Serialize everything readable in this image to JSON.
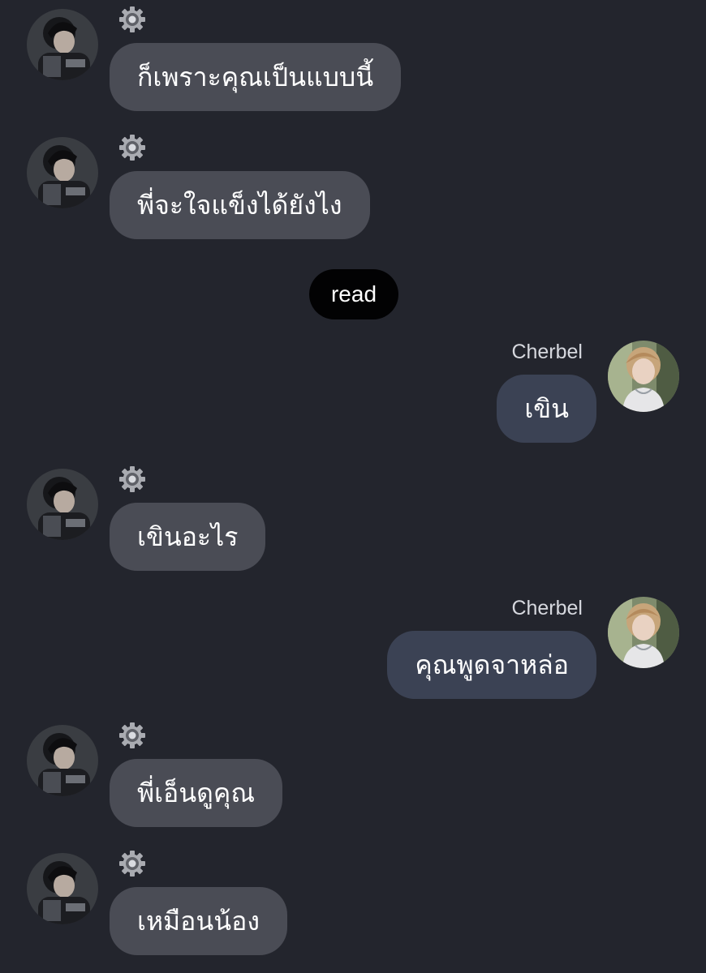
{
  "read_label": "read",
  "contact": {
    "name": "Cherbel",
    "status_icon": "gear-icon"
  },
  "messages": [
    {
      "direction": "incoming",
      "text": "ก็เพราะคุณเป็นแบบนี้"
    },
    {
      "direction": "incoming",
      "text": "พี่จะใจแข็งได้ยังไง"
    },
    {
      "direction": "outgoing",
      "sender": "Cherbel",
      "text": "เขิน"
    },
    {
      "direction": "incoming",
      "text": "เขินอะไร"
    },
    {
      "direction": "outgoing",
      "sender": "Cherbel",
      "text": "คุณพูดจาหล่อ"
    },
    {
      "direction": "incoming",
      "text": "พี่เอ็นดูคุณ"
    },
    {
      "direction": "incoming",
      "text": "เหมือนน้อง"
    }
  ],
  "colors": {
    "background": "#23252d",
    "incoming_bubble": "#4a4c55",
    "outgoing_bubble": "#3b4254",
    "read_pill": "#020203",
    "text": "#ffffff"
  }
}
